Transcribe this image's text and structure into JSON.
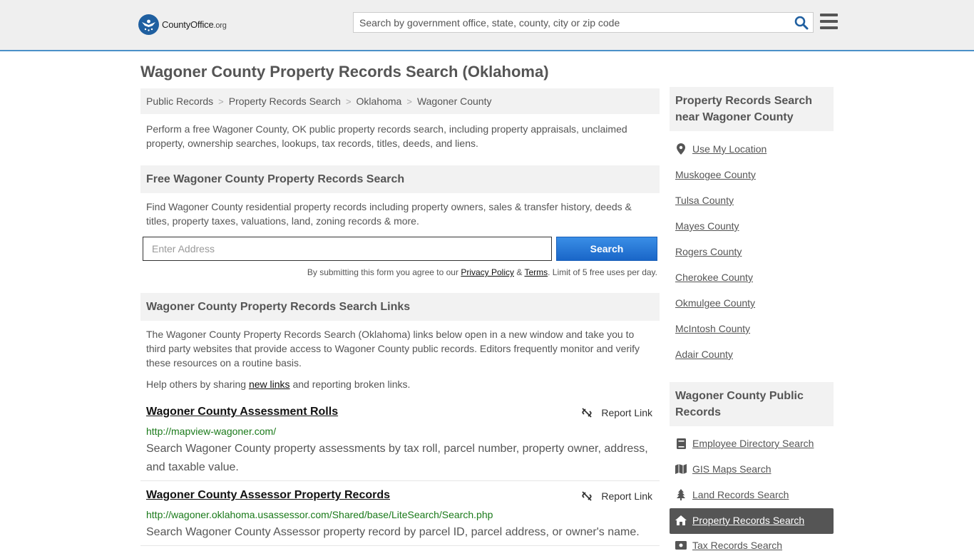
{
  "header": {
    "logo_main": "CountyOffice",
    "logo_suffix": ".org",
    "search_placeholder": "Search by government office, state, county, city or zip code",
    "brand_color": "#1f5fa0"
  },
  "page": {
    "title": "Wagoner County Property Records Search (Oklahoma)",
    "breadcrumb": [
      "Public Records",
      "Property Records Search",
      "Oklahoma",
      "Wagoner County"
    ],
    "breadcrumb_sep": ">",
    "intro": "Perform a free Wagoner County, OK public property records search, including property appraisals, unclaimed property, ownership searches, lookups, tax records, titles, deeds, and liens."
  },
  "free_search": {
    "heading": "Free Wagoner County Property Records Search",
    "description": "Find Wagoner County residential property records including property owners, sales & transfer history, deeds & titles, property taxes, valuations, land, zoning records & more.",
    "address_placeholder": "Enter Address",
    "button_label": "Search",
    "disclaimer_prefix": "By submitting this form you agree to our ",
    "privacy_label": "Privacy Policy",
    "amp": " & ",
    "terms_label": "Terms",
    "disclaimer_suffix": ". Limit of 5 free uses per day."
  },
  "links_section": {
    "heading": "Wagoner County Property Records Search Links",
    "description": "The Wagoner County Property Records Search (Oklahoma) links below open in a new window and take you to third party websites that provide access to Wagoner County public records. Editors frequently monitor and verify these resources on a routine basis.",
    "help_prefix": "Help others by sharing ",
    "help_link": "new links",
    "help_suffix": " and reporting broken links.",
    "report_label": "Report Link",
    "items": [
      {
        "title": "Wagoner County Assessment Rolls",
        "url": "http://mapview-wagoner.com/",
        "description": "Search Wagoner County property assessments by tax roll, parcel number, property owner, address, and taxable value."
      },
      {
        "title": "Wagoner County Assessor Property Records",
        "url": "http://wagoner.oklahoma.usassessor.com/Shared/base/LiteSearch/Search.php",
        "description": "Search Wagoner County Assessor property record by parcel ID, parcel address, or owner's name."
      }
    ]
  },
  "sidebar": {
    "nearby_heading": "Property Records Search near Wagoner County",
    "use_location": "Use My Location",
    "nearby": [
      "Muskogee County",
      "Tulsa County",
      "Mayes County",
      "Rogers County",
      "Cherokee County",
      "Okmulgee County",
      "McIntosh County",
      "Adair County"
    ],
    "public_heading": "Wagoner County Public Records",
    "public_records": [
      {
        "label": "Employee Directory Search",
        "icon": "book-icon"
      },
      {
        "label": "GIS Maps Search",
        "icon": "map-icon"
      },
      {
        "label": "Land Records Search",
        "icon": "tree-icon"
      },
      {
        "label": "Property Records Search",
        "icon": "home-icon",
        "active": true
      },
      {
        "label": "Tax Records Search",
        "icon": "tax-icon"
      }
    ]
  }
}
